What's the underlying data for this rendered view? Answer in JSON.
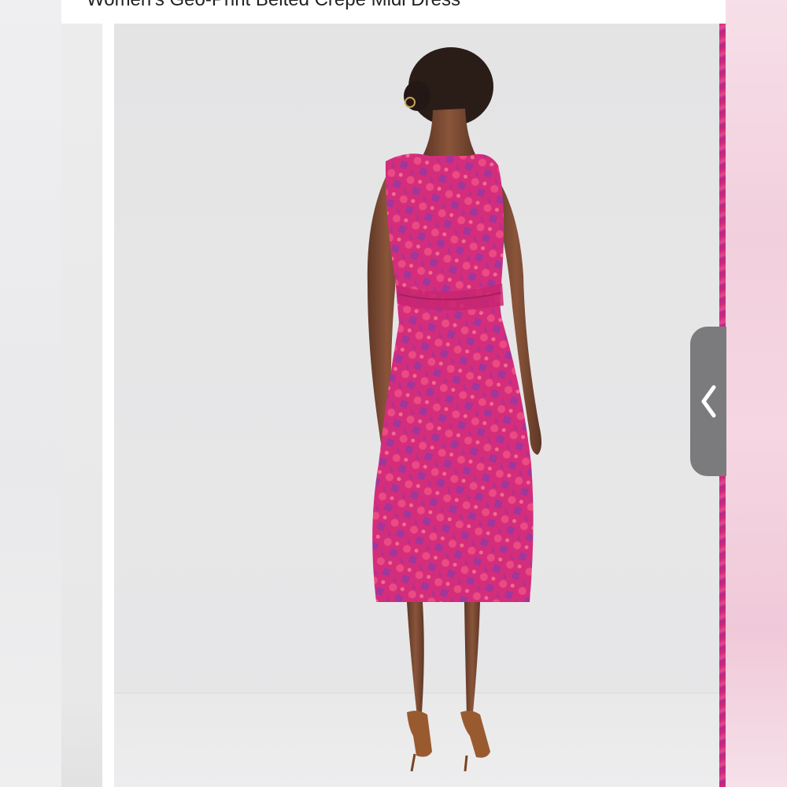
{
  "product": {
    "title": "Women's Geo-Print Belted Crepe Midi Dress"
  },
  "gallery": {
    "prev_icon": "chevron-left-icon",
    "dress_color": "#d6307a",
    "dress_accent": "#9b3aa8",
    "skin_color": "#7a4a33",
    "shoe_color": "#9a5a2f"
  }
}
